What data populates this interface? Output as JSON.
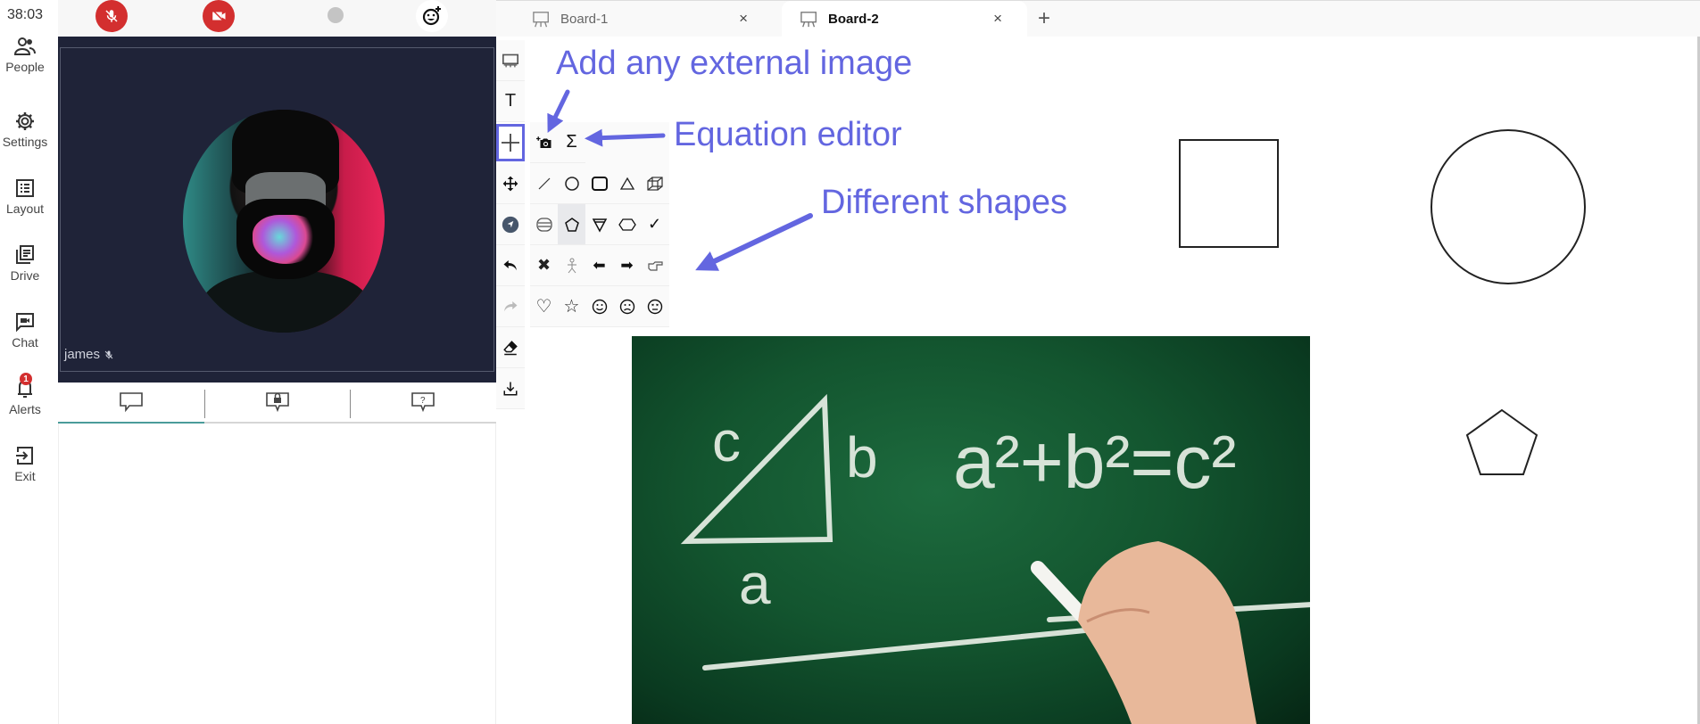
{
  "session": {
    "elapsed_time": "38:03"
  },
  "sidebar": {
    "items": [
      {
        "label": "People",
        "icon": "people-icon"
      },
      {
        "label": "Settings",
        "icon": "gear-icon"
      },
      {
        "label": "Layout",
        "icon": "layout-list-icon"
      },
      {
        "label": "Drive",
        "icon": "drive-files-icon"
      },
      {
        "label": "Chat",
        "icon": "video-chat-icon"
      },
      {
        "label": "Alerts",
        "icon": "bell-icon",
        "badge": "1"
      },
      {
        "label": "Exit",
        "icon": "exit-icon"
      }
    ]
  },
  "controls": {
    "mic": {
      "state": "muted",
      "icon": "mic-off-icon"
    },
    "camera": {
      "state": "off",
      "icon": "camera-off-icon"
    },
    "record": {
      "icon": "record-dot-icon"
    },
    "reactions": {
      "icon": "emoji-add-icon"
    }
  },
  "video": {
    "participant_name": "james",
    "mic_muted": true
  },
  "chat_tabs": [
    {
      "name": "public-chat",
      "icon": "chat-bubble-icon",
      "active": true
    },
    {
      "name": "private-chat",
      "icon": "chat-lock-icon",
      "active": false
    },
    {
      "name": "qa",
      "icon": "chat-question-icon",
      "active": false
    }
  ],
  "boards": {
    "tabs": [
      {
        "label": "Board-1",
        "active": false
      },
      {
        "label": "Board-2",
        "active": true
      }
    ],
    "add_label": "+",
    "close_label": "×"
  },
  "toolbar": {
    "tools": [
      {
        "name": "board",
        "icon": "whiteboard-icon"
      },
      {
        "name": "text",
        "icon": "text-icon",
        "glyph": "T"
      },
      {
        "name": "insert",
        "icon": "plus-icon",
        "active": true
      },
      {
        "name": "move",
        "icon": "move-icon"
      },
      {
        "name": "pointer",
        "icon": "pointer-icon"
      },
      {
        "name": "undo",
        "icon": "undo-icon"
      },
      {
        "name": "redo",
        "icon": "redo-icon"
      },
      {
        "name": "eraser",
        "icon": "eraser-icon"
      },
      {
        "name": "download",
        "icon": "download-icon"
      }
    ]
  },
  "palette": {
    "rows": [
      [
        "add-image",
        "equation"
      ],
      [
        "line",
        "circle",
        "rounded-rect",
        "triangle",
        "cube"
      ],
      [
        "cylinder",
        "pentagon",
        "cone",
        "hexagon",
        "check"
      ],
      [
        "cross",
        "stick-figure",
        "arrow-left",
        "arrow-right",
        "pointing-hand"
      ],
      [
        "heart",
        "star",
        "smiley-happy",
        "smiley-sad",
        "smiley-neutral"
      ]
    ],
    "selected": "pentagon",
    "glyphs": {
      "equation": "Σ",
      "check": "✓",
      "cross": "✖",
      "arrow-left": "⬅",
      "arrow-right": "➡",
      "heart": "♡",
      "star": "☆",
      "smiley-happy": "☺",
      "smiley-sad": "☹",
      "smiley-neutral": "😐"
    }
  },
  "annotations": {
    "add_image": "Add any external image",
    "equation": "Equation editor",
    "shapes": "Different shapes"
  },
  "canvas": {
    "objects": [
      "square",
      "circle",
      "pentagon",
      "image-pythagorean-chalkboard"
    ],
    "image_text": {
      "formula": "a²+b²=c²",
      "labels": [
        "c",
        "b",
        "a"
      ]
    }
  },
  "colors": {
    "accent": "#6366e0",
    "danger": "#d32f2f",
    "video_bg": "#1f2338",
    "tab_active_underline": "#4a9c9a"
  }
}
